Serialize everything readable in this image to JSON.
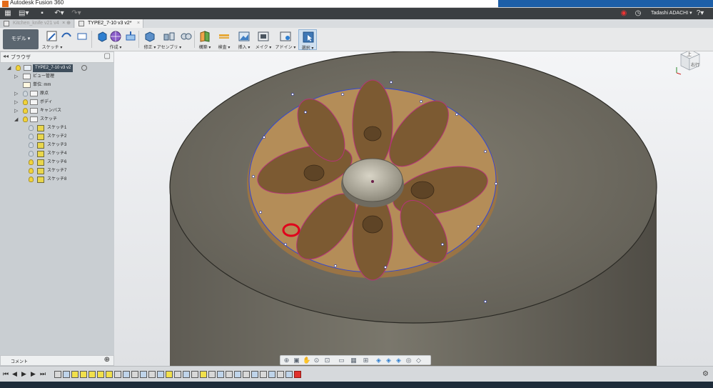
{
  "window": {
    "title": "Autodesk Fusion 360"
  },
  "appbar": {
    "user_name": "Tadashi ADACHI ▾",
    "help_label": "?"
  },
  "tabs": [
    {
      "label": "Kitchen_knife v21 v4",
      "active": false
    },
    {
      "label": "TYPE2_7-10 v3 v2*",
      "active": true
    }
  ],
  "toolbar": {
    "workspace": "モデル ▾",
    "tools": [
      {
        "label": "スケッチ ▾",
        "icon": "sketch-icon"
      },
      {
        "label": "作成 ▾",
        "icon": "create-icon"
      },
      {
        "label": "修正 ▾",
        "icon": "modify-icon"
      },
      {
        "label": "アセンブリ ▾",
        "icon": "assembly-icon"
      },
      {
        "label": "構築 ▾",
        "icon": "construct-icon"
      },
      {
        "label": "検査 ▾",
        "icon": "inspect-icon"
      },
      {
        "label": "挿入 ▾",
        "icon": "insert-icon"
      },
      {
        "label": "メイク ▾",
        "icon": "make-icon"
      },
      {
        "label": "アドイン ▾",
        "icon": "addin-icon"
      },
      {
        "label": "選択 ▾",
        "icon": "select-icon"
      }
    ]
  },
  "browser": {
    "header": "ブラウザ",
    "root": "TYPE2_7-10 v3 v2",
    "items": [
      "ビュー管理",
      "単位: mm",
      "原点",
      "ボディ",
      "キャンバス",
      "スケッチ"
    ],
    "sketches": [
      "スケッチ1",
      "スケッチ2",
      "スケッチ3",
      "スケッチ4",
      "スケッチ6",
      "スケッチ7",
      "スケッチ8"
    ]
  },
  "comment_panel": {
    "header": "コメント"
  },
  "viewcube": {
    "top_face": "上",
    "front_face": "右行"
  },
  "colors": {
    "model_gray": "#6d6a5f",
    "plate_tan": "#b08a55",
    "sketch_blue": "#2f46d6",
    "sketch_magenta": "#b6327a",
    "annotation_red": "#e0001b"
  }
}
